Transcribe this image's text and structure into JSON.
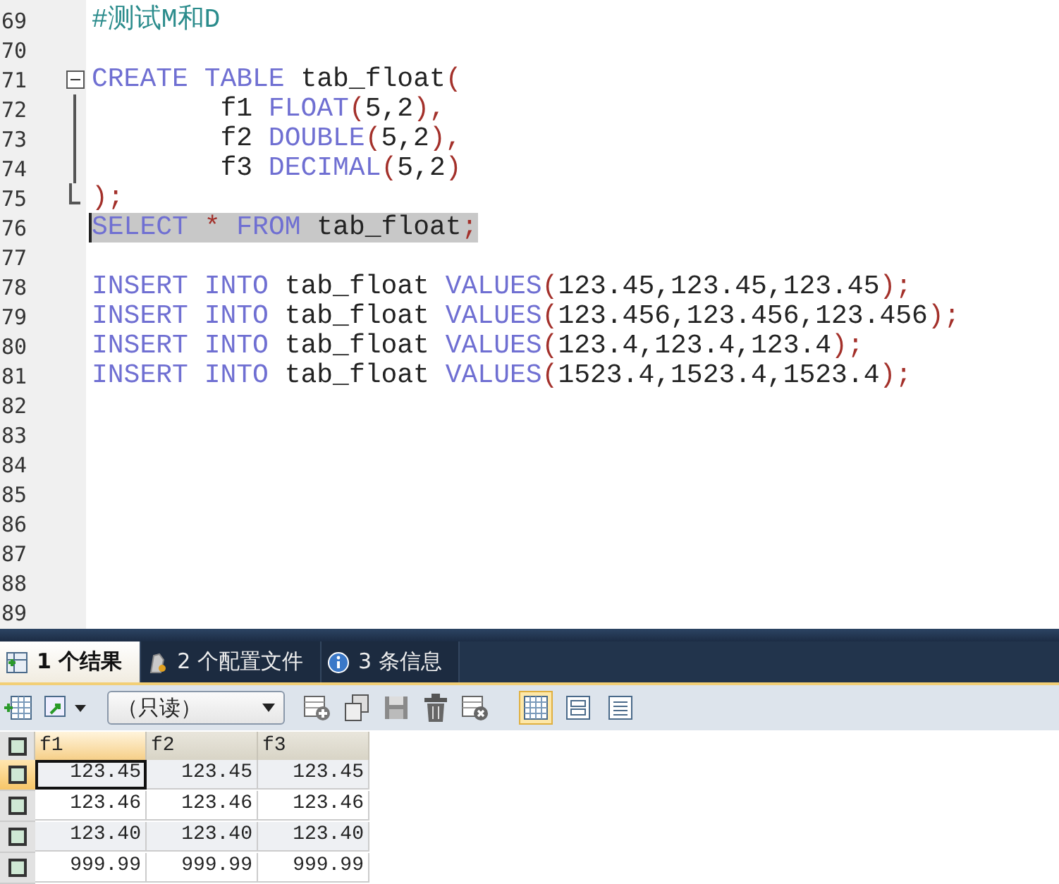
{
  "editor": {
    "lines": [
      {
        "number": "69",
        "tokens": [
          {
            "kind": "comment",
            "text": "#测试M和D"
          }
        ]
      },
      {
        "number": "70"
      },
      {
        "number": "71",
        "expanded": true,
        "tokens": [
          {
            "kind": "keyword",
            "text": "CREATE "
          },
          {
            "kind": "keyword",
            "text": "TABLE "
          },
          {
            "kind": "plain",
            "text": "tab_float"
          },
          {
            "kind": "punct",
            "text": "("
          }
        ],
        "children": [
          {
            "number": "72",
            "tokens": [
              {
                "kind": "plain",
                "text": "        f1 "
              },
              {
                "kind": "keyword",
                "text": "FLOAT"
              },
              {
                "kind": "punct",
                "text": "("
              },
              {
                "kind": "plain",
                "text": "5,2"
              },
              {
                "kind": "punct",
                "text": "),"
              }
            ]
          },
          {
            "number": "73",
            "tokens": [
              {
                "kind": "plain",
                "text": "        f2 "
              },
              {
                "kind": "keyword",
                "text": "DOUBLE"
              },
              {
                "kind": "punct",
                "text": "("
              },
              {
                "kind": "plain",
                "text": "5,2"
              },
              {
                "kind": "punct",
                "text": "),"
              }
            ]
          },
          {
            "number": "74",
            "tokens": [
              {
                "kind": "plain",
                "text": "        f3 "
              },
              {
                "kind": "keyword",
                "text": "DECIMAL"
              },
              {
                "kind": "punct",
                "text": "("
              },
              {
                "kind": "plain",
                "text": "5,2"
              },
              {
                "kind": "punct",
                "text": ")"
              }
            ]
          },
          {
            "number": "75",
            "tokens": [
              {
                "kind": "punct",
                "text": ");"
              }
            ]
          }
        ]
      },
      {
        "number": "76",
        "selected": true,
        "tokens": [
          {
            "kind": "keyword",
            "text": "SELECT "
          },
          {
            "kind": "punct",
            "text": "* "
          },
          {
            "kind": "keyword",
            "text": "FROM "
          },
          {
            "kind": "plain",
            "text": "tab_float"
          },
          {
            "kind": "punct",
            "text": ";"
          }
        ]
      },
      {
        "number": "77"
      },
      {
        "number": "78",
        "tokens": [
          {
            "kind": "keyword",
            "text": "INSERT "
          },
          {
            "kind": "keyword",
            "text": "INTO "
          },
          {
            "kind": "plain",
            "text": "tab_float "
          },
          {
            "kind": "keyword",
            "text": "VALUES"
          },
          {
            "kind": "punct",
            "text": "("
          },
          {
            "kind": "plain",
            "text": "123.45,123.45,123.45"
          },
          {
            "kind": "punct",
            "text": ");"
          }
        ]
      },
      {
        "number": "79",
        "tokens": [
          {
            "kind": "keyword",
            "text": "INSERT "
          },
          {
            "kind": "keyword",
            "text": "INTO "
          },
          {
            "kind": "plain",
            "text": "tab_float "
          },
          {
            "kind": "keyword",
            "text": "VALUES"
          },
          {
            "kind": "punct",
            "text": "("
          },
          {
            "kind": "plain",
            "text": "123.456,123.456,123.456"
          },
          {
            "kind": "punct",
            "text": ");"
          }
        ]
      },
      {
        "number": "80",
        "tokens": [
          {
            "kind": "keyword",
            "text": "INSERT "
          },
          {
            "kind": "keyword",
            "text": "INTO "
          },
          {
            "kind": "plain",
            "text": "tab_float "
          },
          {
            "kind": "keyword",
            "text": "VALUES"
          },
          {
            "kind": "punct",
            "text": "("
          },
          {
            "kind": "plain",
            "text": "123.4,123.4,123.4"
          },
          {
            "kind": "punct",
            "text": ");"
          }
        ]
      },
      {
        "number": "81",
        "tokens": [
          {
            "kind": "keyword",
            "text": "INSERT "
          },
          {
            "kind": "keyword",
            "text": "INTO "
          },
          {
            "kind": "plain",
            "text": "tab_float "
          },
          {
            "kind": "keyword",
            "text": "VALUES"
          },
          {
            "kind": "punct",
            "text": "("
          },
          {
            "kind": "plain",
            "text": "1523.4,1523.4,1523.4"
          },
          {
            "kind": "punct",
            "text": ");"
          }
        ]
      },
      {
        "number": "82"
      },
      {
        "number": "83"
      },
      {
        "number": "84"
      },
      {
        "number": "85"
      },
      {
        "number": "86"
      },
      {
        "number": "87"
      },
      {
        "number": "88"
      },
      {
        "number": "89"
      }
    ]
  },
  "result_tabs": [
    {
      "kind": "result",
      "label": "1 个结果",
      "selected": true
    },
    {
      "kind": "profile",
      "label": "2 个配置文件",
      "selected": false
    },
    {
      "kind": "info",
      "label": "3 条信息",
      "selected": false
    }
  ],
  "toolbar": {
    "mode_select": {
      "value": "（只读）"
    },
    "view_modes": [
      {
        "kind": "grid",
        "selected": true
      },
      {
        "kind": "form",
        "selected": false
      },
      {
        "kind": "text",
        "selected": false
      }
    ]
  },
  "grid": {
    "select_all": {
      "checked": false
    },
    "columns": [
      "f1",
      "f2",
      "f3"
    ],
    "rows": [
      {
        "selected": true,
        "cells": [
          "123.45",
          "123.45",
          "123.45"
        ]
      },
      {
        "selected": false,
        "cells": [
          "123.46",
          "123.46",
          "123.46"
        ]
      },
      {
        "selected": false,
        "cells": [
          "123.40",
          "123.40",
          "123.40"
        ]
      },
      {
        "selected": false,
        "cells": [
          "999.99",
          "999.99",
          "999.99"
        ]
      }
    ]
  }
}
